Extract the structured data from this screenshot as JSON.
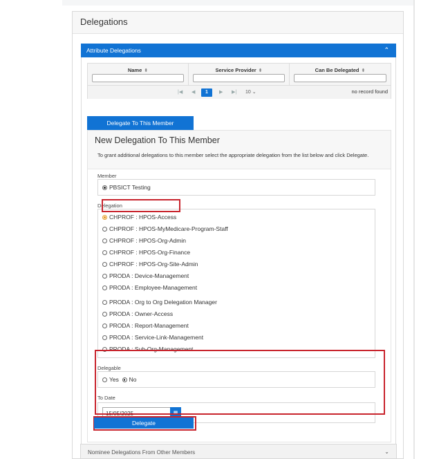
{
  "panel": {
    "title": "Delegations"
  },
  "attribute_delegations": {
    "header": "Attribute Delegations",
    "columns": [
      "Name",
      "Service Provider",
      "Can Be Delegated"
    ],
    "pager": {
      "current_page": "1",
      "page_size": "10"
    },
    "empty_message": "no record found"
  },
  "delegate_to_member_button": "Delegate To This Member",
  "new_delegation": {
    "title": "New Delegation To This Member",
    "description": "To grant additional delegations to this member select the appropriate delegation from the list below and click Delegate.",
    "member_label": "Member",
    "member_value": "PBSICT Testing",
    "delegation_label": "Delegation",
    "delegations": [
      "CHPROF : HPOS-Access",
      "CHPROF : HPOS-MyMedicare-Program-Staff",
      "CHPROF : HPOS-Org-Admin",
      "CHPROF : HPOS-Org-Finance",
      "CHPROF : HPOS-Org-Site-Admin",
      "PRODA : Device-Management",
      "PRODA : Employee-Management",
      "PRODA : Org to Org Delegation Manager",
      "PRODA : Owner-Access",
      "PRODA : Report-Management",
      "PRODA : Service-Link-Management",
      "PRODA : Sub-Org-Management"
    ],
    "selected_delegation": "CHPROF : HPOS-Access",
    "delegable_label": "Delegable",
    "delegable_yes": "Yes",
    "delegable_no": "No",
    "delegable_selected": "No",
    "to_date_label": "To Date",
    "to_date_value": "15/05/2025"
  },
  "delegate_button": "Delegate",
  "nominee_delegations": {
    "header": "Nominee Delegations From Other Members"
  },
  "colors": {
    "accent": "#1173d4",
    "highlight": "#c8232c"
  }
}
